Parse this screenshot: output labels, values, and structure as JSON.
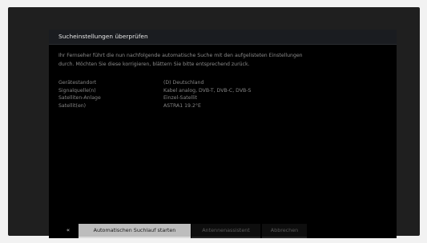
{
  "dialog": {
    "title": "Sucheinstellungen überprüfen",
    "intro_line1": "Ihr Fernseher führt die nun nachfolgende automatische Suche mit den aufgelisteten Einstellungen",
    "intro_line2": "durch. Möchten Sie diese korrigieren, blättern Sie bitte entsprechend zurück."
  },
  "settings": [
    {
      "label": "Gerätestandort",
      "value": "(D) Deutschland"
    },
    {
      "label": "Signalquelle(n)",
      "value": "Kabel analog, DVB-T, DVB-C, DVB-S"
    },
    {
      "label": "Satelliten-Anlage",
      "value": "Einzel-Satellit"
    },
    {
      "label": "Satellit(en)",
      "value": "ASTRA1 19.2°E"
    }
  ],
  "footer": {
    "back_icon": "double-chevron-left-icon",
    "back_glyph": "«",
    "primary_label": "Automatischen Suchlauf starten",
    "secondary_label": "Antennenassistent",
    "tertiary_label": "Abbrechen"
  }
}
